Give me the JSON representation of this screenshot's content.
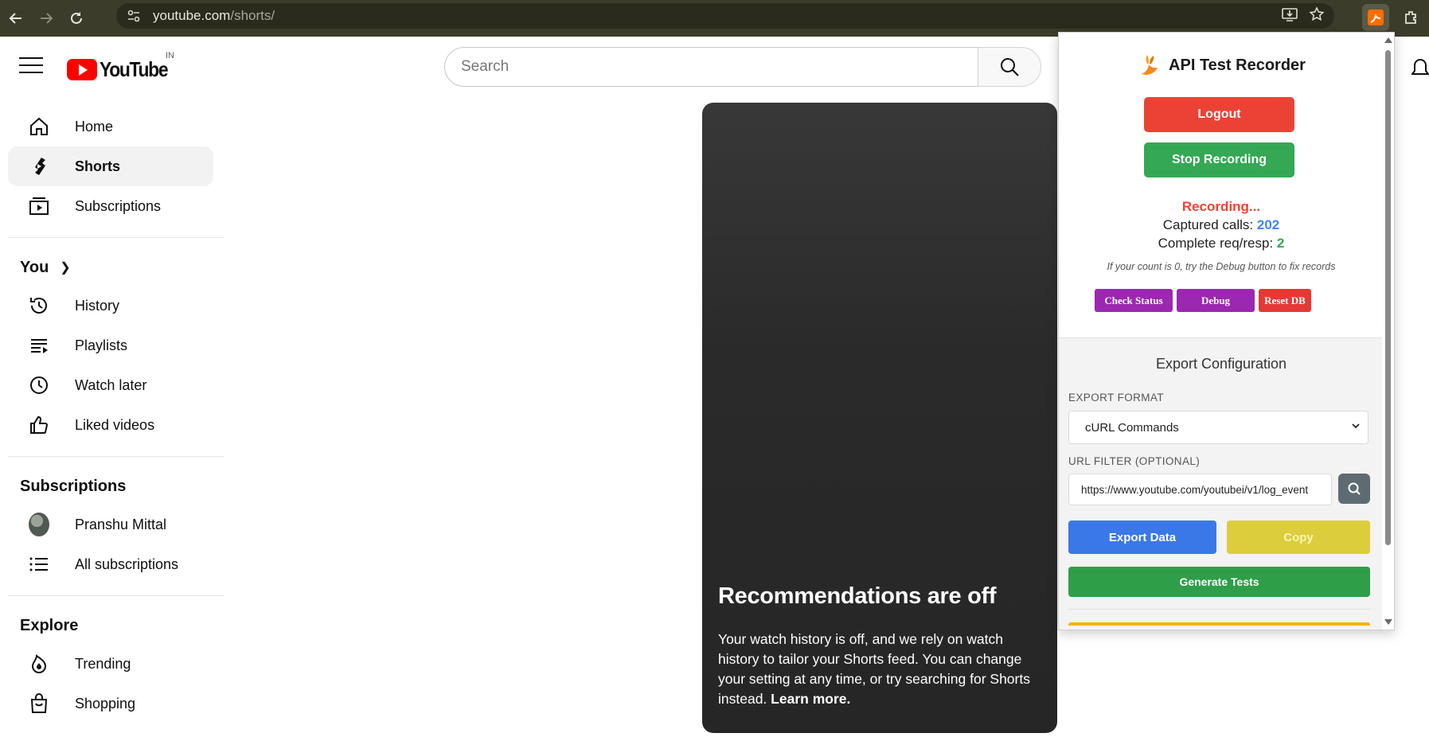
{
  "browser": {
    "url_host": "youtube.com",
    "url_path": "/shorts/"
  },
  "youtube": {
    "country_code": "IN",
    "search_placeholder": "Search",
    "sidebar": {
      "main": [
        {
          "label": "Home",
          "icon": "home-icon"
        },
        {
          "label": "Shorts",
          "icon": "shorts-icon",
          "active": true
        },
        {
          "label": "Subscriptions",
          "icon": "subscriptions-icon"
        }
      ],
      "you_heading": "You",
      "you_items": [
        {
          "label": "History",
          "icon": "history-icon"
        },
        {
          "label": "Playlists",
          "icon": "playlists-icon"
        },
        {
          "label": "Watch later",
          "icon": "watch-later-icon"
        },
        {
          "label": "Liked videos",
          "icon": "thumbs-up-icon"
        }
      ],
      "subscriptions_heading": "Subscriptions",
      "subscription_items": [
        {
          "label": "Pranshu Mittal",
          "icon": "avatar"
        },
        {
          "label": "All subscriptions",
          "icon": "list-icon"
        }
      ],
      "explore_heading": "Explore",
      "explore_items": [
        {
          "label": "Trending",
          "icon": "trending-icon"
        },
        {
          "label": "Shopping",
          "icon": "shopping-bag-icon"
        }
      ]
    },
    "shorts_card": {
      "title": "Recommendations are off",
      "body": "Your watch history is off, and we rely on watch history to tailor your Shorts feed. You can change your setting at any time, or try searching for Shorts instead.",
      "link": "Learn more."
    }
  },
  "extension": {
    "title": "API Test Recorder",
    "logout_label": "Logout",
    "stop_label": "Stop Recording",
    "recording_status": "Recording...",
    "captured_label": "Captured calls:",
    "captured_count": "202",
    "complete_label": "Complete req/resp:",
    "complete_count": "2",
    "hint": "If your count is 0, try the Debug button to fix records",
    "check_status_label": "Check Status",
    "debug_label": "Debug",
    "reset_label": "Reset DB",
    "export": {
      "heading": "Export Configuration",
      "format_label": "EXPORT FORMAT",
      "format_value": "cURL Commands",
      "filter_label": "URL FILTER (OPTIONAL)",
      "filter_value": "https://www.youtube.com/youtubei/v1/log_event",
      "export_label": "Export Data",
      "copy_label": "Copy",
      "generate_label": "Generate Tests"
    },
    "colors": {
      "red": "#ea4335",
      "green": "#34a853",
      "blue": "#4285f4",
      "purple": "#9c27b0",
      "yellow": "#dccd3c"
    }
  }
}
